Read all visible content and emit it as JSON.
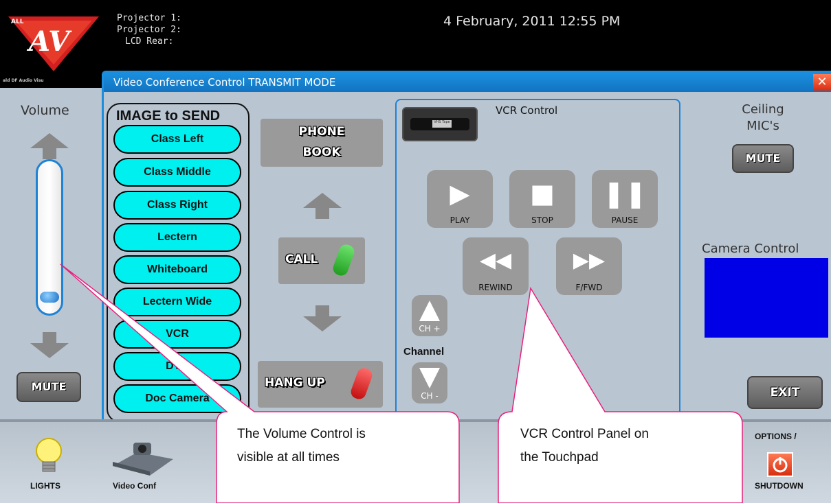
{
  "status": {
    "projector1": "Projector 1:",
    "projector2": "Projector 2:",
    "lcd_rear": "LCD Rear:",
    "datetime": "4 February, 2011  12:55 PM"
  },
  "logo": {
    "text": "AV",
    "top_text": "ALL",
    "tagline": "ald DF Audio Visu"
  },
  "window": {
    "title": "Video Conference Control TRANSMIT MODE",
    "close_symbol": "✕"
  },
  "volume": {
    "label": "Volume",
    "mute_label": "MUTE",
    "level": 0.05
  },
  "image_to_send": {
    "title": "IMAGE to SEND",
    "sources": [
      "Class Left",
      "Class Middle",
      "Class Right",
      "Lectern",
      "Whiteboard",
      "Lectern Wide",
      "VCR",
      "DVD",
      "Doc Camera"
    ]
  },
  "phone": {
    "phonebook_line1": "PHONE",
    "phonebook_line2": "BOOK",
    "call_label": "CALL",
    "hangup_label": "HANG UP"
  },
  "vcr": {
    "title": "VCR Control",
    "tape_label": "VHS Tape",
    "play": "PLAY",
    "stop": "STOP",
    "pause": "PAUSE",
    "rewind": "REWIND",
    "ffwd": "F/FWD",
    "channel": "Channel",
    "ch_up": "CH +",
    "ch_down": "CH -"
  },
  "ceiling_mics": {
    "label_line1": "Ceiling",
    "label_line2": "MIC's",
    "mute_label": "MUTE"
  },
  "camera_control": {
    "label": "Camera Control",
    "preview_color": "#0000e6"
  },
  "exit_label": "EXIT",
  "bottom": {
    "lights": "LIGHTS",
    "video_conf": "Video Conf",
    "options": "OPTIONS /",
    "shutdown": "SHUTDOWN"
  },
  "callouts": {
    "volume_line1": "The Volume Control is",
    "volume_line2": "visible at all times",
    "vcr_line1": "VCR Control Panel on",
    "vcr_line2": "the Touchpad"
  },
  "colors": {
    "panel_bg": "#b9c5d1",
    "accent_blue": "#1e82d5",
    "source_button": "#00f0f0",
    "callout_border": "#e8207d"
  }
}
